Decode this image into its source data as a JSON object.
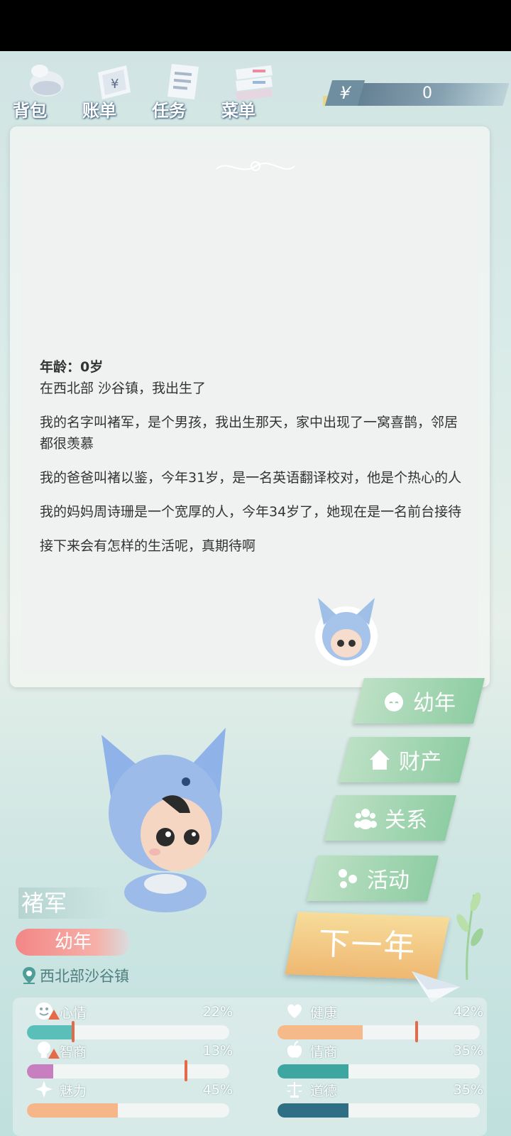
{
  "menu": [
    {
      "label": "背包",
      "icon": "backpack-icon"
    },
    {
      "label": "账单",
      "icon": "bill-icon"
    },
    {
      "label": "任务",
      "icon": "task-icon"
    },
    {
      "label": "菜单",
      "icon": "menu-icon"
    }
  ],
  "money": {
    "symbol": "¥",
    "value": "0"
  },
  "story": {
    "age_line": "年龄：0岁",
    "paragraphs": [
      "在西北部 沙谷镇，我出生了",
      "我的名字叫褚军，是个男孩，我出生那天，家中出现了一窝喜鹊，邻居都很羡慕",
      "我的爸爸叫褚以鉴，今年31岁，是一名英语翻译校对，他是个热心的人",
      "我的妈妈周诗珊是一个宽厚的人，今年34岁了，她现在是一名前台接待",
      "接下来会有怎样的生活呢，真期待啊"
    ]
  },
  "side_buttons": [
    {
      "label": "幼年",
      "icon": "baby-face-icon"
    },
    {
      "label": "财产",
      "icon": "house-icon"
    },
    {
      "label": "关系",
      "icon": "people-icon"
    },
    {
      "label": "活动",
      "icon": "activity-icon"
    }
  ],
  "next_button": "下一年",
  "character": {
    "name": "褚军",
    "stage": "幼年",
    "location": "西北部沙谷镇"
  },
  "stats": [
    {
      "label": "心情",
      "pct": "22%",
      "value": 22,
      "mark": 22,
      "color": "#5bbfb9",
      "icon": "smile-icon",
      "warning": true
    },
    {
      "label": "健康",
      "pct": "42%",
      "value": 42,
      "mark": 68,
      "color": "#f5b98a",
      "icon": "heart-icon",
      "warning": false
    },
    {
      "label": "智商",
      "pct": "13%",
      "value": 13,
      "mark": 78,
      "color": "#c77fc0",
      "icon": "bulb-icon",
      "warning": true
    },
    {
      "label": "情商",
      "pct": "35%",
      "value": 35,
      "mark": null,
      "color": "#3ea6a0",
      "icon": "apple-icon",
      "warning": false
    },
    {
      "label": "魅力",
      "pct": "45%",
      "value": 45,
      "mark": null,
      "color": "#f5b78a",
      "icon": "sparkle-icon",
      "warning": false
    },
    {
      "label": "道德",
      "pct": "35%",
      "value": 35,
      "mark": null,
      "color": "#2f6f86",
      "icon": "scales-icon",
      "warning": false
    }
  ]
}
